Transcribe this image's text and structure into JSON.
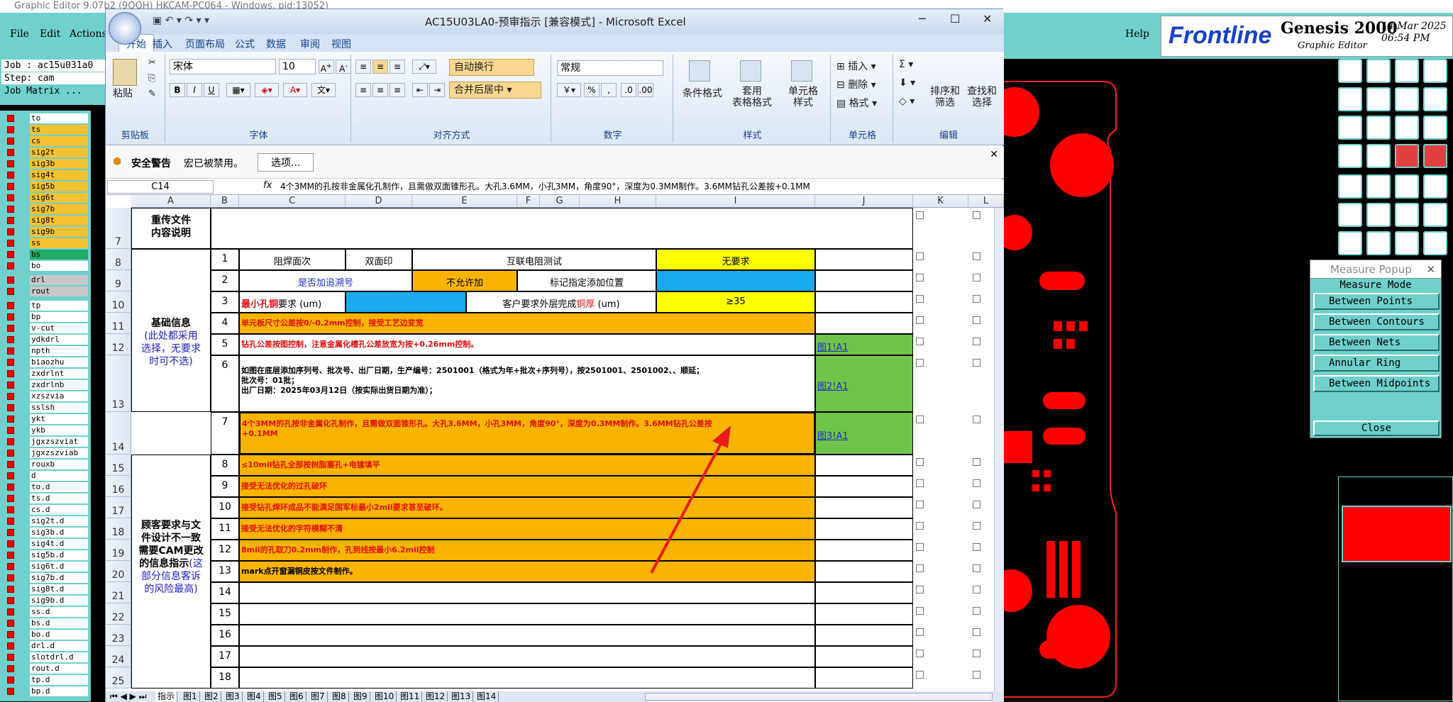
{
  "genesis": {
    "title": "Graphic Editor 9.07b2 (9QQH) HKCAM-PC064 - Windows, pid:13052)",
    "menu": [
      "File",
      "Edit",
      "Actions"
    ],
    "help": "Help",
    "brand": "Frontline",
    "product": "Genesis 2000",
    "product_sub": "Graphic Editor",
    "date": "14 Mar 2025",
    "time": "06:54 PM",
    "job": "Job : ac15u031a0",
    "step": "Step: cam",
    "job_matrix": "Job Matrix ...",
    "layers": [
      "to",
      "ts",
      "cs",
      "sig2t",
      "sig3b",
      "sig4t",
      "sig5b",
      "sig6t",
      "sig7b",
      "sig8t",
      "sig9b",
      "ss",
      "bs",
      "bo",
      "drl",
      "rout",
      "tp",
      "bp",
      "v-cut",
      "ydkdrl",
      "npth",
      "biaozhu",
      "zxdrlnt",
      "zxdrlnb",
      "xzszvia",
      "sslsh",
      "ykt",
      "ykb",
      "jgxzszviat",
      "jgxzszviab",
      "rouxb",
      "d",
      "to.d",
      "ts.d",
      "cs.d",
      "sig2t.d",
      "sig3b.d",
      "sig4t.d",
      "sig5b.d",
      "sig6t.d",
      "sig7b.d",
      "sig8t.d",
      "sig9b.d",
      "ss.d",
      "bs.d",
      "bo.d",
      "drl.d",
      "slotdrl.d",
      "rout.d",
      "tp.d",
      "bp.d"
    ],
    "measure": {
      "title": "Measure Popup",
      "mode": "Measure Mode",
      "options": [
        "Between Points",
        "Between Contours",
        "Between Nets",
        "Annular Ring",
        "Between Midpoints"
      ],
      "close": "Close"
    }
  },
  "excel": {
    "title": "AC15U03LA0-预审指示  [兼容模式] - Microsoft Excel",
    "tabs": [
      "开始",
      "插入",
      "页面布局",
      "公式",
      "数据",
      "审阅",
      "视图"
    ],
    "ribbon": {
      "paste": "粘贴",
      "clipboard": "剪贴板",
      "font_name": "宋体",
      "font_size": "10",
      "font_group": "字体",
      "wrap": "自动换行",
      "merge": "合并后居中",
      "align_group": "对齐方式",
      "numfmt": "常规",
      "num_group": "数字",
      "cond": "条件格式",
      "table": "套用\n表格格式",
      "cellstyle": "单元格\n样式",
      "style_group": "样式",
      "insert": "插入",
      "delete": "删除",
      "format": "格式",
      "cells_group": "单元格",
      "sort": "排序和\n筛选",
      "find": "查找和\n选择",
      "edit_group": "编辑"
    },
    "security": {
      "label": "安全警告",
      "msg": "宏已被禁用。",
      "btn": "选项..."
    },
    "namebox": "C14",
    "formula": "4个3MM的孔按非金属化孔制作，且需做双面锥形孔。大孔3.6MM，小孔3MM，角度90°，深度为0.3MM制作。3.6MM钻孔公差按+0.1MM",
    "cols": [
      "A",
      "B",
      "C",
      "D",
      "E",
      "F",
      "G",
      "H",
      "I",
      "J",
      "K",
      "L"
    ],
    "rows": [
      "7",
      "8",
      "9",
      "10",
      "11",
      "12",
      "13",
      "14",
      "15",
      "16",
      "17",
      "18",
      "19",
      "20",
      "21",
      "22",
      "23",
      "24",
      "25"
    ],
    "sec1": "重传文件\n内容说明",
    "sec2": "基础信息",
    "sec2b": "(此处都采用\n选择，无要求\n时可不选)",
    "sec3": "顾客要求与文\n件设计不一致\n需要CAM更改\n的信息指示",
    "sec3b": "(这\n部分信息客诉\n的风险最高)",
    "r8": {
      "n": "1",
      "a": "阻焊面次",
      "b": "双面印",
      "c": "互联电阻测试",
      "d": "无要求"
    },
    "r9": {
      "n": "2",
      "a": "是否加追溯号",
      "b": "不允许加",
      "c": "标记指定添加位置"
    },
    "r10": {
      "n": "3",
      "a1": "最小孔铜",
      "a2": "要求 (um)",
      "c1": "客户要求外层完成",
      "c2": "铜厚",
      "c3": " (um)",
      "d": "≥35"
    },
    "r11": {
      "n": "4",
      "t": "单元板尺寸公差按0/-0.2mm控制，接受工艺边变宽"
    },
    "r12": {
      "n": "5",
      "t": "钻孔公差按图控制，注意金属化槽孔公差放宽为按+0.26mm控制。",
      "link": "图1!A1"
    },
    "r13": {
      "n": "6",
      "t": "如图在底层添加序列号、批次号、出厂日期，生产编号：2501001（格式为年+批次+序列号），按2501001、2501002、、顺延；\n批次号：01批；\n出厂日期：2025年03月12日（按实际出货日期为准）；",
      "link": "图2!A1"
    },
    "r14": {
      "n": "7",
      "t": "4个3MM的孔按非金属化孔制作，且需做双面锥形孔。大孔3.6MM，小孔3MM，角度90°，深度为0.3MM制作。3.6MM钻孔公差按\n+0.1MM",
      "link": "图3!A1"
    },
    "r15": {
      "n": "8",
      "t": "≤10mil钻孔全部按树脂塞孔+电镀填平"
    },
    "r16": {
      "n": "9",
      "t": "接受无法优化的过孔破环"
    },
    "r17": {
      "n": "10",
      "t": "接受钻孔焊环成品不能满足国军标最小2mil要求甚至破环。"
    },
    "r18": {
      "n": "11",
      "t": "接受无法优化的字符模糊不清"
    },
    "r19": {
      "n": "12",
      "t": "8mil的孔取刀0.2mm制作，孔到线按最小6.2mil控制"
    },
    "r20": {
      "n": "13",
      "t": "mark点开窗漏铜皮按文件制作。"
    },
    "empty_nums": [
      "14",
      "15",
      "16",
      "17",
      "18"
    ],
    "sheets": [
      "指示",
      "图1",
      "图2",
      "图3",
      "图4",
      "图5",
      "图6",
      "图7",
      "图8",
      "图9",
      "图10",
      "图11",
      "图12",
      "图13",
      "图14"
    ]
  }
}
